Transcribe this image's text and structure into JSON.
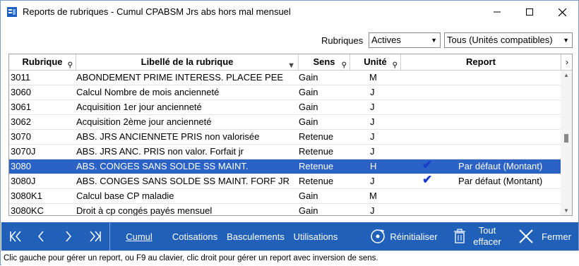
{
  "window": {
    "title": "Reports de rubriques - Cumul CPABSM Jrs abs hors mal mensuel"
  },
  "filters": {
    "label": "Rubriques",
    "select1": "Actives",
    "select2": "Tous (Unités compatibles)"
  },
  "columns": [
    "Rubrique",
    "Libellé de la rubrique",
    "Sens",
    "Unité",
    "Report"
  ],
  "rows": [
    {
      "code": "3011",
      "label": "ABONDEMENT PRIME INTERESS. PLACEE PEE",
      "sens": "Gain",
      "unite": "M",
      "check": "",
      "report": ""
    },
    {
      "code": "3060",
      "label": "Calcul Nombre de mois ancienneté",
      "sens": "Gain",
      "unite": "J",
      "check": "",
      "report": ""
    },
    {
      "code": "3061",
      "label": "Acquisition 1er jour ancienneté",
      "sens": "Gain",
      "unite": "J",
      "check": "",
      "report": ""
    },
    {
      "code": "3062",
      "label": "Acquisition 2ème jour ancienneté",
      "sens": "Gain",
      "unite": "J",
      "check": "",
      "report": ""
    },
    {
      "code": "3070",
      "label": "ABS. JRS ANCIENNETE PRIS non valorisée",
      "sens": "Retenue",
      "unite": "J",
      "check": "",
      "report": ""
    },
    {
      "code": "3070J",
      "label": "ABS. JRS ANC. PRIS non valor. Forfait jr",
      "sens": "Retenue",
      "unite": "J",
      "check": "",
      "report": ""
    },
    {
      "code": "3080",
      "label": "ABS. CONGES SANS SOLDE SS MAINT.",
      "sens": "Retenue",
      "unite": "H",
      "check": "✔",
      "report": "Par défaut (Montant)"
    },
    {
      "code": "3080J",
      "label": "ABS. CONGES SANS SOLDE SS MAINT. FORF JR",
      "sens": "Retenue",
      "unite": "J",
      "check": "✔",
      "report": "Par défaut (Montant)"
    },
    {
      "code": "3080K1",
      "label": "Calcul base CP maladie",
      "sens": "Gain",
      "unite": "M",
      "check": "",
      "report": ""
    },
    {
      "code": "3080KC",
      "label": "Droit à cp congés payés mensuel",
      "sens": "Gain",
      "unite": "J",
      "check": "",
      "report": ""
    }
  ],
  "toolbar": {
    "cumul": "Cumul",
    "cotisations": "Cotisations",
    "basculements": "Basculements",
    "utilisations": "Utilisations",
    "reinitialiser": "Réinitialiser",
    "tout_effacer_1": "Tout",
    "tout_effacer_2": "effacer",
    "fermer": "Fermer"
  },
  "status": "Clic gauche pour gérer un report, ou F9 au clavier, clic droit pour gérer un report avec inversion de sens.",
  "colors": {
    "toolbar": "#2060b8",
    "selected_row": "#2a62c6",
    "check": "#1a3cc8"
  }
}
